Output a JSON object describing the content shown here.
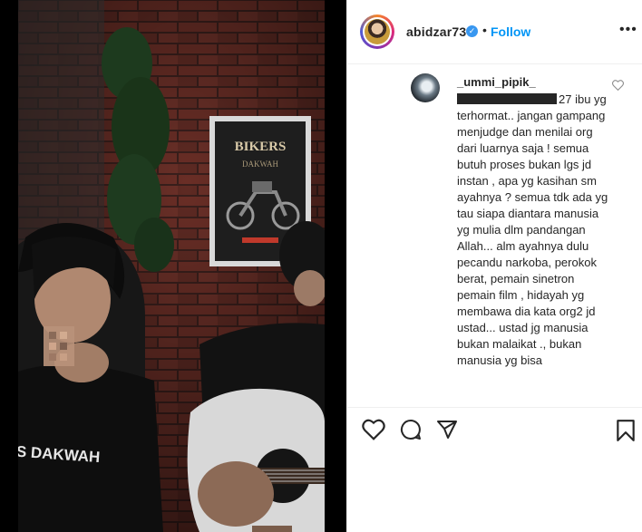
{
  "post": {
    "username": "abidzar73",
    "follow_label": "Follow",
    "separator": "•",
    "more_label": "•••",
    "verified_mark": "✓"
  },
  "comment": {
    "username": "_ummi_pipik_",
    "mention_suffix": "27",
    "text": "ibu yg terhormat.. jangan gampang menjudge dan menilai org dari luarnya saja ! semua butuh proses bukan lgs jd instan , apa yg kasihan sm ayahnya ? semua tdk ada yg tau siapa diantara manusia yg mulia dlm pandangan Allah... alm ayahnya dulu pecandu narkoba, perokok berat, pemain sinetron pemain film , hidayah yg membawa dia kata org2 jd ustad... ustad jg manusia bukan malaikat ., bukan manusia yg bisa"
  },
  "media": {
    "poster_line1": "BIKERS",
    "poster_line2": "DAKWAH",
    "shirt_text": "S DAKWAH"
  },
  "icons": {
    "like": "heart-icon",
    "comment": "comment-icon",
    "share": "share-icon",
    "save": "bookmark-icon",
    "comment_like": "comment-heart-icon",
    "verified": "verified-badge-icon"
  },
  "colors": {
    "follow": "#0095f6",
    "verified": "#3897f0",
    "text": "#262626"
  }
}
